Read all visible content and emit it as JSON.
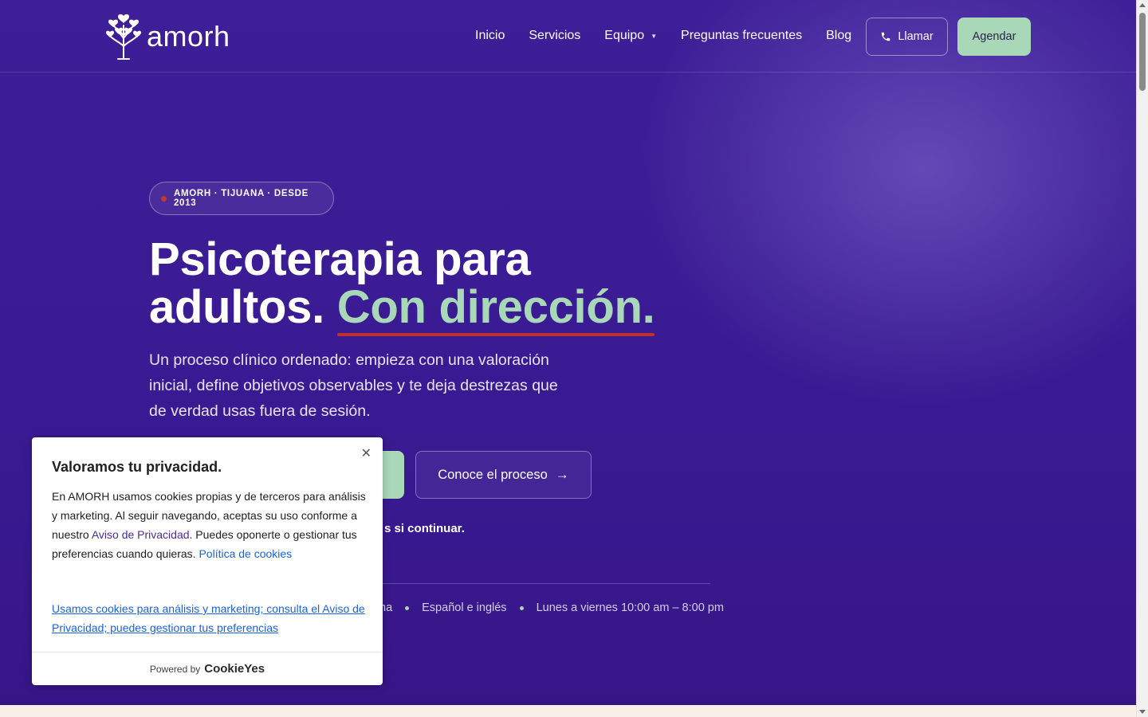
{
  "header": {
    "logo_text": "amorh",
    "nav": {
      "inicio": "Inicio",
      "servicios": "Servicios",
      "equipo": "Equipo",
      "faq": "Preguntas frecuentes",
      "blog": "Blog"
    },
    "call_label": "Llamar",
    "schedule_label": "Agendar"
  },
  "hero": {
    "badge": "AMORH · TIJUANA · DESDE 2013",
    "title_line1": "Psicoterapia para",
    "title_line2": "adultos.",
    "title_accent": "Con dirección.",
    "subtitle": "Un proceso clínico ordenado: empieza con una valoración inicial, define objetivos observables y te deja destrezas que de verdad usas fuera de sesión.",
    "secondary_button": "Conoce el proceso",
    "note_visible": "s si continuar.",
    "facts": [
      "na",
      "Español e inglés",
      "Lunes a viernes 10:00 am – 8:00 pm"
    ]
  },
  "cookie": {
    "title": "Valoramos tu privacidad.",
    "body_part1": "En AMORH usamos cookies propias y de terceros para análisis y marketing. Al seguir navegando, aceptas su uso conforme a nuestro ",
    "privacy_link": "Aviso de Privacidad",
    "body_part2": ". Puedes oponerte o gestionar tus preferencias cuando quieras. ",
    "cookie_policy_link": "Política de cookies",
    "summary_link": "Usamos cookies para análisis y marketing; consulta el Aviso de Privacidad; puedes gestionar tus preferencias",
    "powered_by": "Powered by",
    "powered_brand": "CookieYes"
  },
  "colors": {
    "background": "#3f1f97",
    "accent_green": "#a9d8b8",
    "underline_red": "#c0302c"
  }
}
